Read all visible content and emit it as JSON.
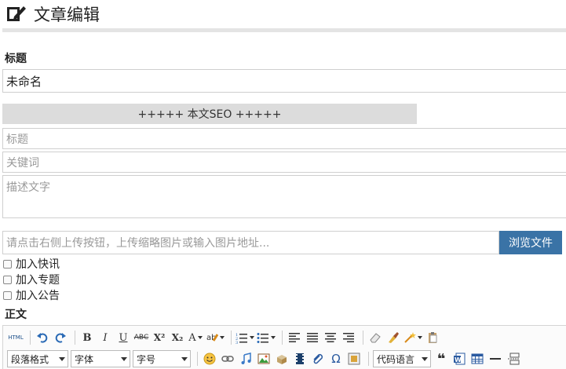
{
  "header": {
    "title": "文章编辑"
  },
  "form": {
    "title_label": "标题",
    "title_value": "未命名",
    "seo_bar": "+++++ 本文SEO +++++",
    "seo_title_placeholder": "标题",
    "seo_keywords_placeholder": "关键词",
    "seo_desc_placeholder": "描述文字",
    "thumb_placeholder": "请点击右侧上传按钮，上传缩略图片或输入图片地址...",
    "browse_label": "浏览文件",
    "checkboxes": [
      {
        "label": "加入快讯",
        "checked": false
      },
      {
        "label": "加入专题",
        "checked": false
      },
      {
        "label": "加入公告",
        "checked": false
      }
    ],
    "body_label": "正文"
  },
  "editor": {
    "html_btn": "HTML",
    "bold": "B",
    "italic": "I",
    "underline": "U",
    "strike": "ABC",
    "superscript": "X²",
    "subscript": "X₂",
    "font_color": "A",
    "selects": {
      "paragraph": "段落格式",
      "font": "字体",
      "size": "字号",
      "code": "代码语言"
    },
    "omega": "Ω",
    "quote": "❝",
    "accent_color": "#3a73a6"
  }
}
